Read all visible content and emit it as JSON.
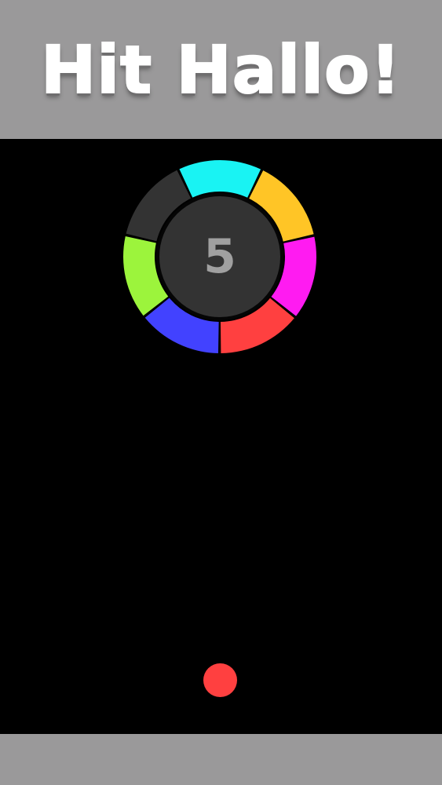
{
  "header": {
    "title": "Hit Hallo!"
  },
  "wheel": {
    "score": "5",
    "segments": [
      {
        "name": "segment-dark",
        "color": "#333333"
      },
      {
        "name": "segment-cyan",
        "color": "#19f3f3"
      },
      {
        "name": "segment-yellow",
        "color": "#ffc526"
      },
      {
        "name": "segment-magenta",
        "color": "#ff1bf1"
      },
      {
        "name": "segment-red",
        "color": "#ff4040"
      },
      {
        "name": "segment-blue",
        "color": "#4242ff"
      },
      {
        "name": "segment-green",
        "color": "#9cf43c"
      }
    ],
    "hub_color": "#333333",
    "score_color": "#a0a0a0"
  },
  "ball": {
    "color": "#ff4040"
  },
  "colors": {
    "bar": "#9a999a",
    "background": "#000000"
  }
}
